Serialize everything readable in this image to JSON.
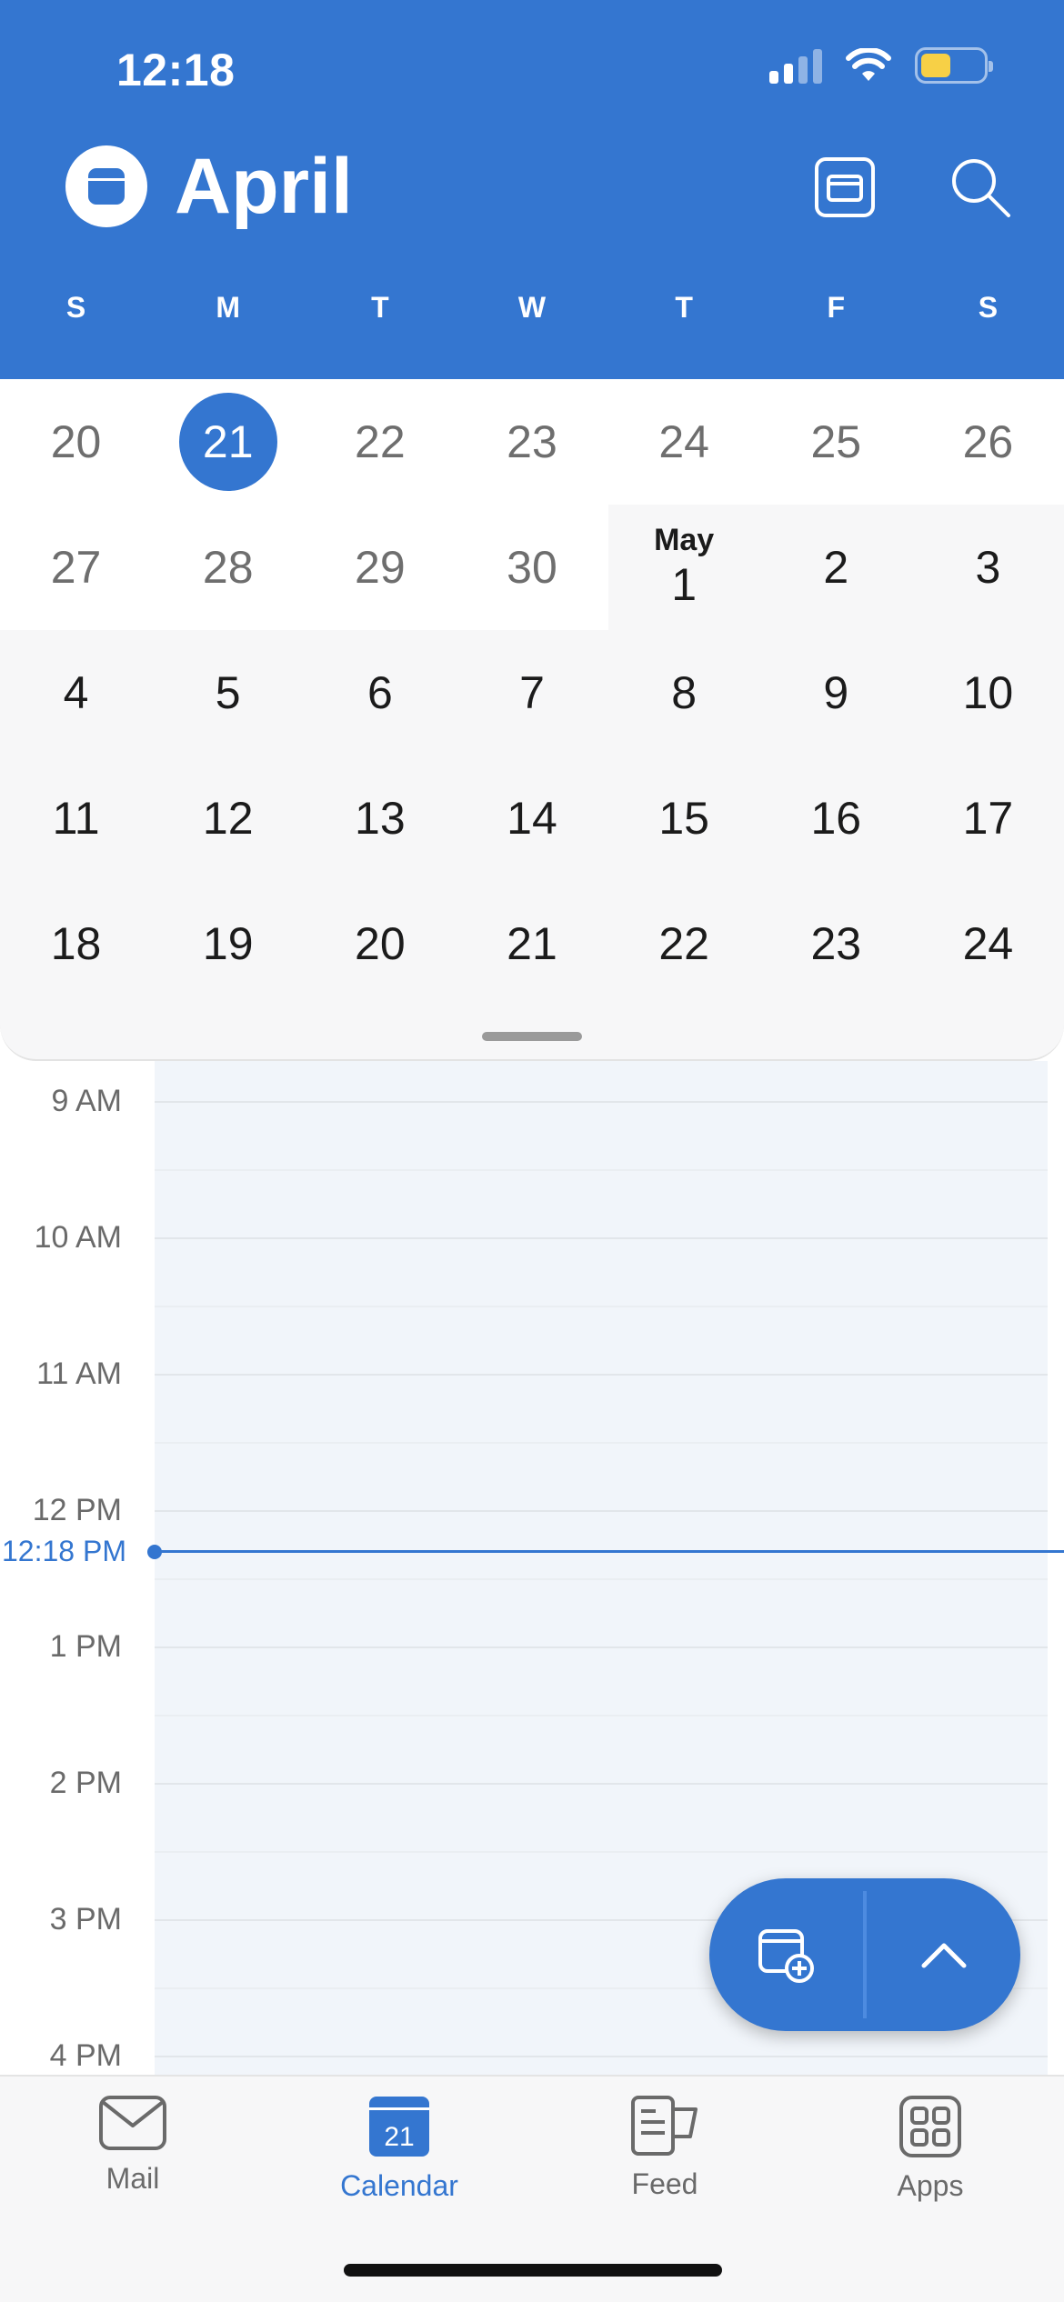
{
  "status_bar": {
    "time": "12:18"
  },
  "header": {
    "month": "April"
  },
  "weekdays": [
    "S",
    "M",
    "T",
    "W",
    "T",
    "F",
    "S"
  ],
  "weeks": [
    [
      {
        "d": "20",
        "m": "april"
      },
      {
        "d": "21",
        "m": "april",
        "today": true
      },
      {
        "d": "22",
        "m": "april"
      },
      {
        "d": "23",
        "m": "april"
      },
      {
        "d": "24",
        "m": "april"
      },
      {
        "d": "25",
        "m": "april"
      },
      {
        "d": "26",
        "m": "april"
      }
    ],
    [
      {
        "d": "27",
        "m": "april"
      },
      {
        "d": "28",
        "m": "april"
      },
      {
        "d": "29",
        "m": "april"
      },
      {
        "d": "30",
        "m": "april"
      },
      {
        "d": "1",
        "m": "may",
        "label": "May"
      },
      {
        "d": "2",
        "m": "may"
      },
      {
        "d": "3",
        "m": "may"
      }
    ],
    [
      {
        "d": "4"
      },
      {
        "d": "5"
      },
      {
        "d": "6"
      },
      {
        "d": "7"
      },
      {
        "d": "8"
      },
      {
        "d": "9"
      },
      {
        "d": "10"
      }
    ],
    [
      {
        "d": "11"
      },
      {
        "d": "12"
      },
      {
        "d": "13"
      },
      {
        "d": "14"
      },
      {
        "d": "15"
      },
      {
        "d": "16"
      },
      {
        "d": "17"
      }
    ],
    [
      {
        "d": "18"
      },
      {
        "d": "19"
      },
      {
        "d": "20"
      },
      {
        "d": "21"
      },
      {
        "d": "22"
      },
      {
        "d": "23"
      },
      {
        "d": "24"
      }
    ]
  ],
  "timeline": {
    "hours": [
      "9 AM",
      "10 AM",
      "11 AM",
      "12 PM",
      "1 PM",
      "2 PM",
      "3 PM",
      "4 PM"
    ],
    "current_time": "12:18 PM"
  },
  "tabs": [
    {
      "label": "Mail",
      "icon": "mail-icon"
    },
    {
      "label": "Calendar",
      "icon": "calendar-icon",
      "badge": "21",
      "active": true
    },
    {
      "label": "Feed",
      "icon": "feed-icon"
    },
    {
      "label": "Apps",
      "icon": "apps-icon"
    }
  ],
  "colors": {
    "accent": "#3476d0",
    "today_bg": "#3476d0",
    "battery": "#f7d046"
  }
}
